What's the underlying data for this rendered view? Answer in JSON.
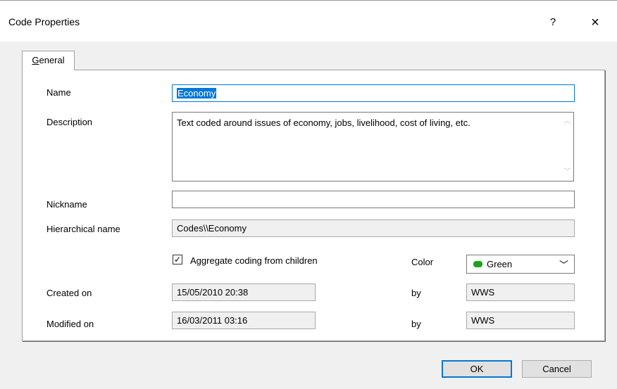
{
  "window": {
    "title": "Code Properties",
    "help": "?",
    "close": "×"
  },
  "tabs": [
    {
      "label_underlined": "G",
      "label_rest": "eneral"
    }
  ],
  "form": {
    "name_label": "Name",
    "name_value": "Economy",
    "description_label": "Description",
    "description_value": "Text coded around issues of economy, jobs, livelihood, cost of living, etc.",
    "nickname_label": "Nickname",
    "nickname_value": "",
    "hierarchical_label": "Hierarchical name",
    "hierarchical_value": "Codes\\\\Economy",
    "aggregate_label": "Aggregate coding from children",
    "aggregate_checked": "✓",
    "color_label": "Color",
    "color_value": "Green",
    "color_swatch": "#1ea21e",
    "created_label": "Created on",
    "created_value": "15/05/2010 20:38",
    "created_by_label": "by",
    "created_by_value": "WWS",
    "modified_label": "Modified on",
    "modified_value": "16/03/2011 03:16",
    "modified_by_label": "by",
    "modified_by_value": "WWS"
  },
  "buttons": {
    "ok": "OK",
    "cancel": "Cancel"
  },
  "icons": {
    "scroll_up": "chevron-up-icon",
    "scroll_down": "chevron-down-icon",
    "dropdown": "chevron-down-icon"
  }
}
